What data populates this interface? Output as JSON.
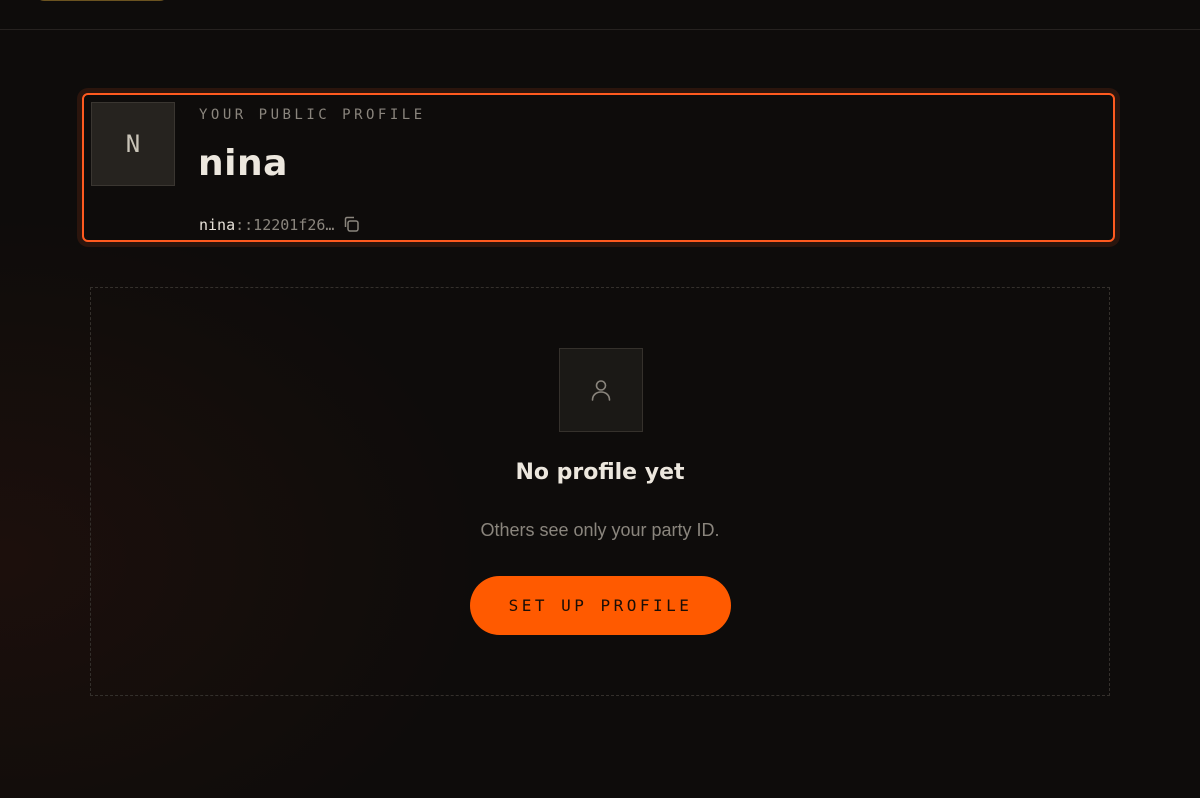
{
  "profile_card": {
    "avatar_initial": "N",
    "eyebrow": "YOUR PUBLIC PROFILE",
    "name": "nina",
    "party_id_prefix": "nina",
    "party_id_suffix": "::12201f26…",
    "copy_icon": "copy-icon",
    "accent_color": "#ff5a1f"
  },
  "empty_state": {
    "icon": "user-icon",
    "title": "No profile yet",
    "description": "Others see only your party ID.",
    "button_label": "SET UP PROFILE",
    "button_color": "#ff5a00"
  }
}
